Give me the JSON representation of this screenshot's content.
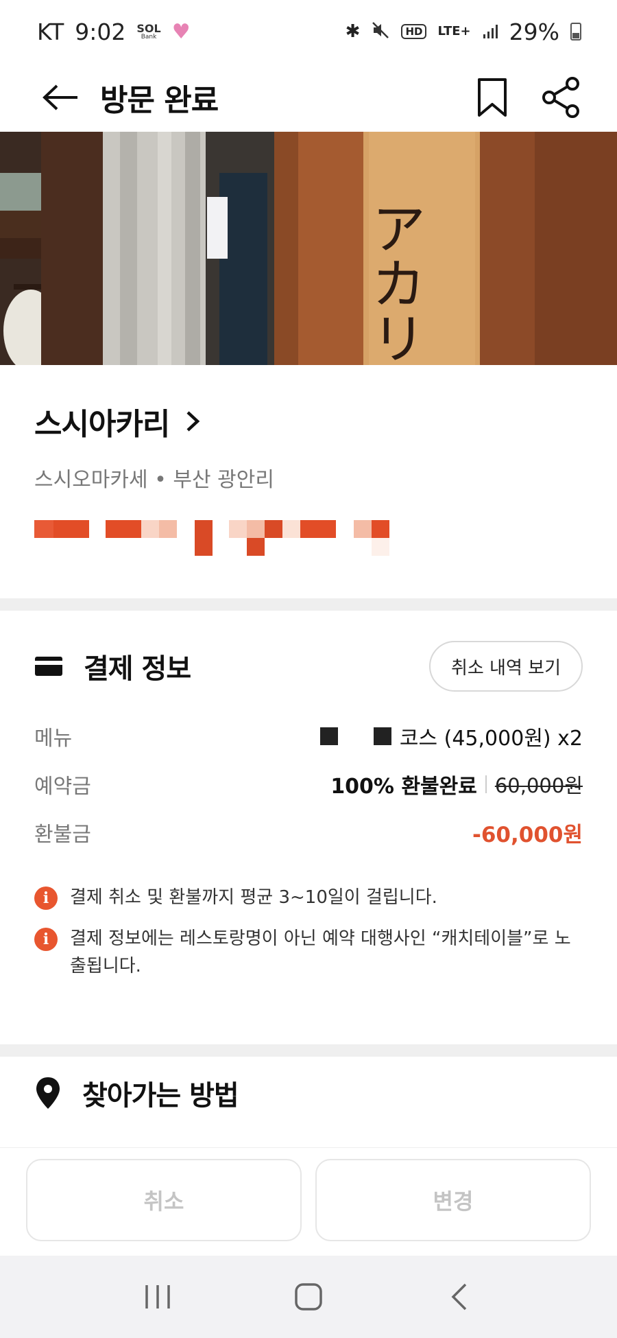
{
  "status_bar": {
    "carrier": "KT",
    "time": "9:02",
    "sol_label": "SOL",
    "bank_label": "Bank",
    "hd_label": "HD",
    "network": "LTE+",
    "battery": "29%"
  },
  "header": {
    "title": "방문 완료"
  },
  "restaurant": {
    "name": "스시아카리",
    "category": "스시오마카세",
    "separator": "•",
    "location": "부산 광안리",
    "sign_text": "アカリ"
  },
  "payment": {
    "title": "결제 정보",
    "cancel_history_label": "취소 내역 보기",
    "rows": [
      {
        "label": "메뉴",
        "value": "코스 (45,000원) x2"
      },
      {
        "label": "예약금",
        "status": "100% 환불완료",
        "original": "60,000원"
      },
      {
        "label": "환불금",
        "value": "-60,000원"
      }
    ],
    "notes": [
      "결제 취소 및 환불까지 평균 3~10일이 걸립니다.",
      "결제 정보에는 레스토랑명이 아닌 예약 대행사인 “캐치테이블”로 노출됩니다."
    ],
    "note_icon": "i"
  },
  "directions": {
    "title": "찾아가는 방법"
  },
  "actions": {
    "cancel_label": "취소",
    "change_label": "변경"
  },
  "colors": {
    "accent": "#e0522f",
    "muted": "#777777",
    "disabled": "#c4c4c4"
  },
  "icons": {
    "back": "back-arrow-icon",
    "bookmark": "bookmark-icon",
    "share": "share-icon",
    "card": "credit-card-icon",
    "location": "location-pin-icon",
    "info": "info-icon"
  }
}
